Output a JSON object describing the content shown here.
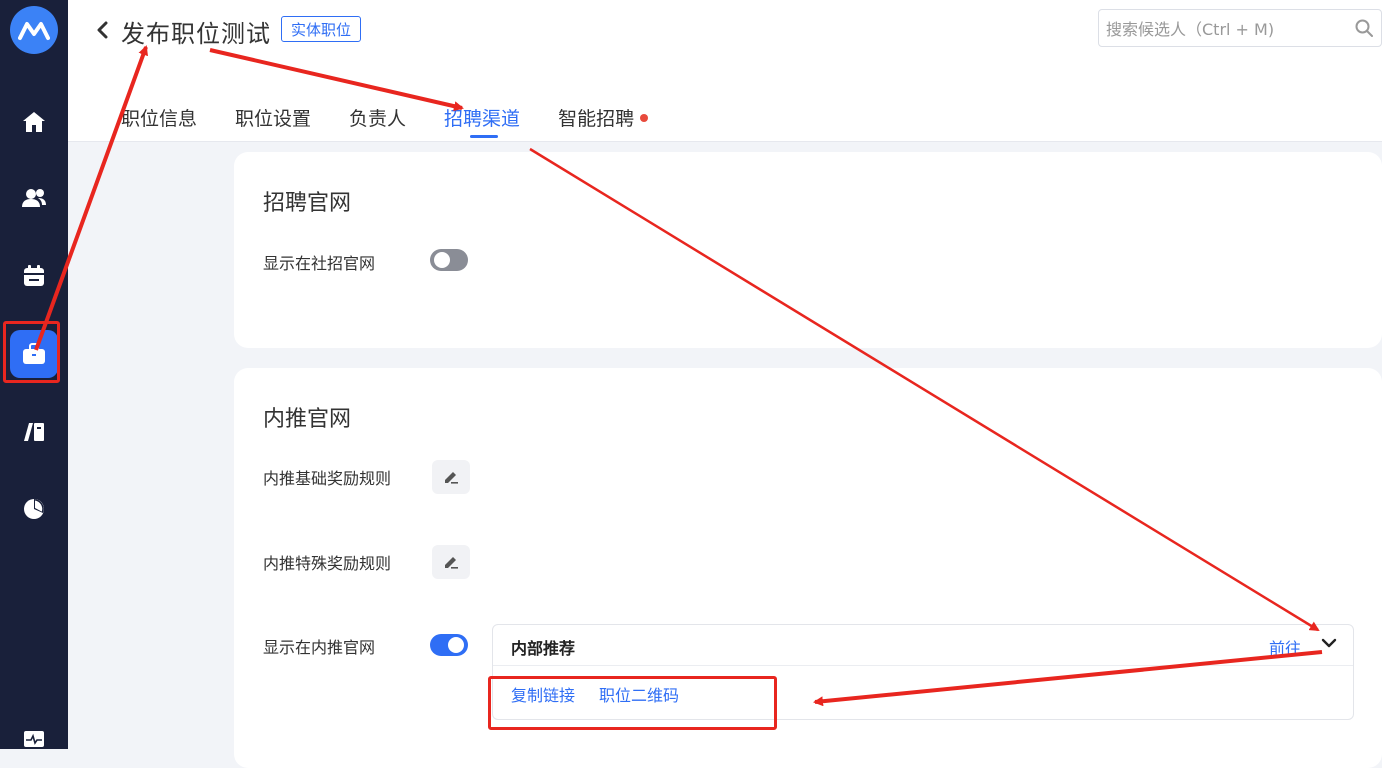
{
  "header": {
    "title": "发布职位测试",
    "tag": "实体职位",
    "search_placeholder": "搜索候选人（Ctrl + M)"
  },
  "tabs": [
    {
      "label": "职位信息",
      "active": false
    },
    {
      "label": "职位设置",
      "active": false
    },
    {
      "label": "负责人",
      "active": false
    },
    {
      "label": "招聘渠道",
      "active": true
    },
    {
      "label": "智能招聘",
      "active": false,
      "badge": "red-dot"
    }
  ],
  "sidebar": {
    "items": [
      {
        "icon": "home-icon"
      },
      {
        "icon": "users-icon"
      },
      {
        "icon": "calendar-icon"
      },
      {
        "icon": "briefcase-icon",
        "active": true
      },
      {
        "icon": "book-icon"
      },
      {
        "icon": "pie-chart-icon"
      },
      {
        "icon": "activity-icon"
      }
    ]
  },
  "official_site": {
    "title": "招聘官网",
    "show_label": "显示在社招官网",
    "show_enabled": false
  },
  "referral_site": {
    "title": "内推官网",
    "basic_reward_label": "内推基础奖励规则",
    "special_reward_label": "内推特殊奖励规则",
    "show_label": "显示在内推官网",
    "show_enabled": true,
    "panel": {
      "title": "内部推荐",
      "goto": "前往",
      "copy_link": "复制链接",
      "qr_code": "职位二维码"
    }
  },
  "colors": {
    "primary": "#2f6ef5",
    "sidebar_bg": "#19203a",
    "annotation": "#e8261f"
  }
}
